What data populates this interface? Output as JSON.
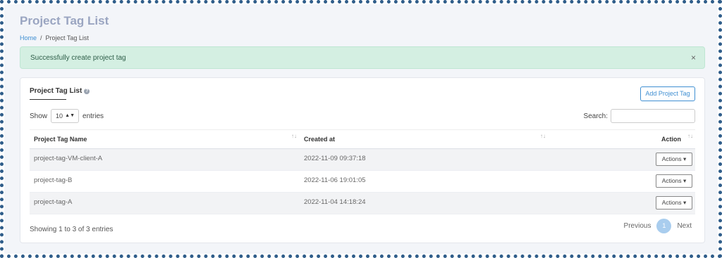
{
  "header": {
    "title": "Project Tag List"
  },
  "breadcrumb": {
    "home": "Home",
    "separator": "/",
    "current": "Project Tag List"
  },
  "alert": {
    "message": "Successfully create project tag",
    "close": "×"
  },
  "card": {
    "title": "Project Tag List",
    "help_icon": "?",
    "add_button": "Add Project Tag",
    "show_label": "Show",
    "entries_value": "10",
    "select_arrow": "▲▼",
    "entries_label": "entries",
    "search_label": "Search:"
  },
  "table": {
    "columns": [
      "Project Tag Name",
      "Created at",
      "Action"
    ],
    "sort_icon": "↑↓",
    "rows": [
      {
        "name": "project-tag-VM-client-A",
        "created": "2022-11-09 09:37:18",
        "action": "Actions ▾"
      },
      {
        "name": "project-tag-B",
        "created": "2022-11-06 19:01:05",
        "action": "Actions ▾"
      },
      {
        "name": "project-tag-A",
        "created": "2022-11-04 14:18:24",
        "action": "Actions ▾"
      }
    ]
  },
  "footer": {
    "info": "Showing 1 to 3 of 3 entries",
    "previous": "Previous",
    "page": "1",
    "next": "Next"
  },
  "colors": {
    "accent": "#3f8fd2",
    "alert_bg": "#d4efe2",
    "title": "#9aa5c1",
    "frame": "#2f5d8a"
  }
}
